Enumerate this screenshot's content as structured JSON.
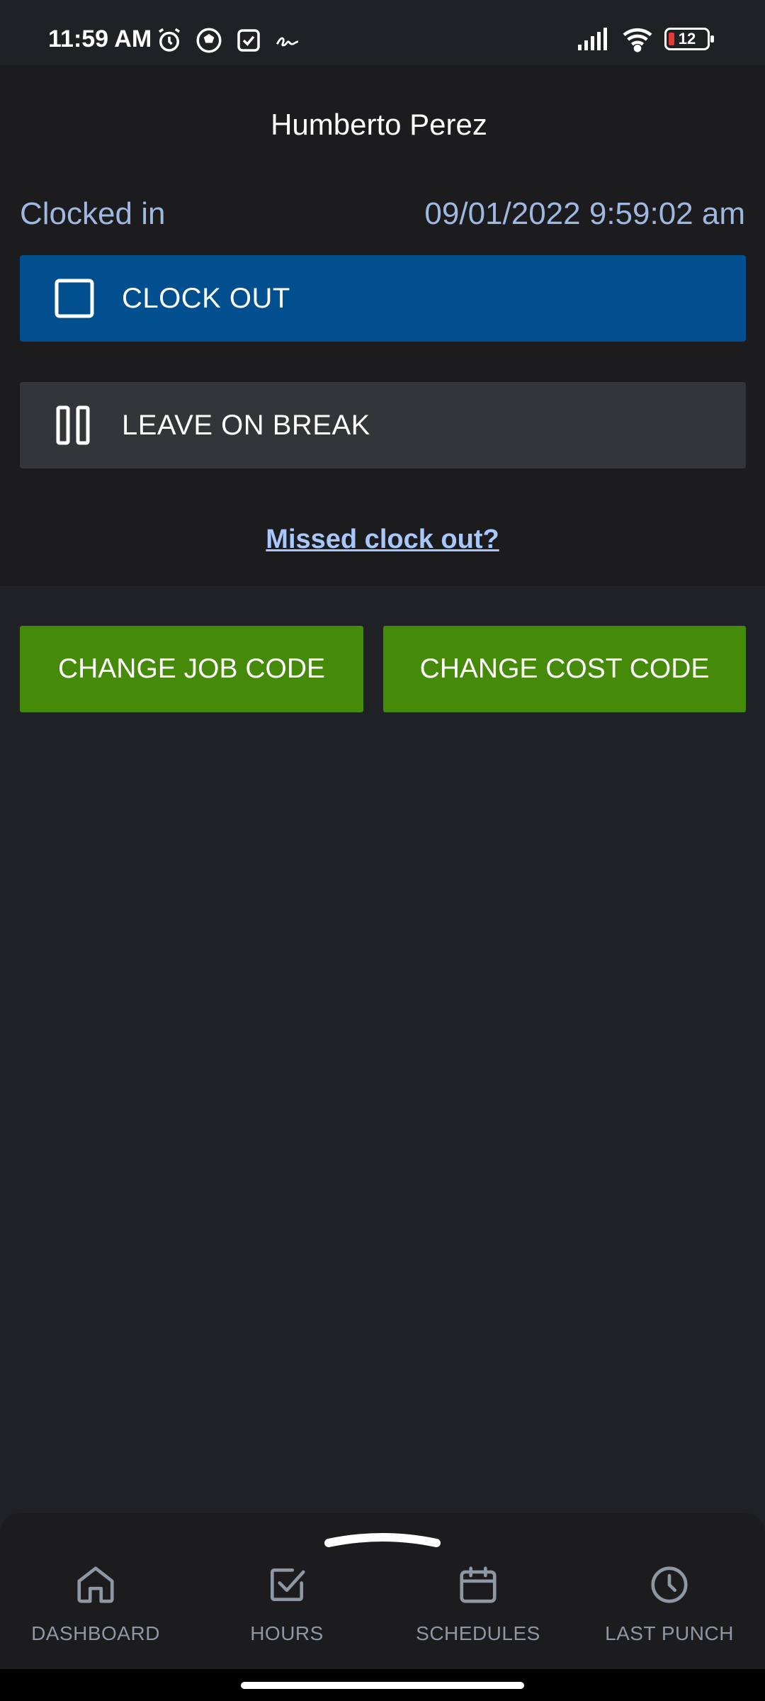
{
  "status_bar": {
    "time": "11:59 AM",
    "icons_left": [
      "alarm-icon",
      "soccer-ball-icon",
      "checkbox-icon",
      "signature-icon"
    ],
    "icons_right": [
      "cell-signal-icon",
      "wifi-icon",
      "battery-icon"
    ],
    "battery_level": "12"
  },
  "header": {
    "employee_name": "Humberto Perez"
  },
  "punch_status": {
    "label": "Clocked in",
    "timestamp": "09/01/2022 9:59:02 am"
  },
  "actions": {
    "clock_out_label": "CLOCK OUT",
    "break_label": "LEAVE ON BREAK",
    "missed_link": "Missed clock out?",
    "change_job_code": "CHANGE JOB CODE",
    "change_cost_code": "CHANGE COST CODE"
  },
  "bottom_nav": {
    "items": [
      {
        "label": "DASHBOARD",
        "icon": "home-icon"
      },
      {
        "label": "HOURS",
        "icon": "checked-square-icon"
      },
      {
        "label": "SCHEDULES",
        "icon": "calendar-icon"
      },
      {
        "label": "LAST PUNCH",
        "icon": "clock-icon"
      }
    ]
  },
  "colors": {
    "background": "#202124",
    "panel": "#1c1c1e",
    "clock_out_blue": "#024f8f",
    "break_gray": "#333538",
    "action_green": "#458a08",
    "accent_text": "#9fb8e0",
    "link": "#a8c7fa",
    "nav_text": "#8e97a3"
  }
}
